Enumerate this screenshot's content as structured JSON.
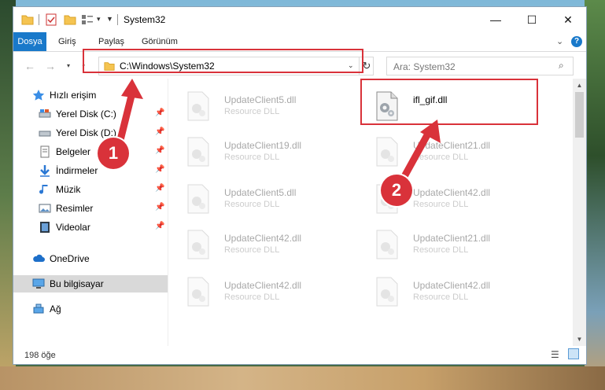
{
  "window": {
    "title": "System32",
    "controls": {
      "minimize": "—",
      "maximize": "☐",
      "close": "✕"
    }
  },
  "ribbon": {
    "tabs": [
      {
        "label": "Dosya"
      },
      {
        "label": "Giriş"
      },
      {
        "label": "Paylaş"
      },
      {
        "label": "Görünüm"
      }
    ],
    "help": "?"
  },
  "address": {
    "path": "C:\\Windows\\System32",
    "search_placeholder": "Ara: System32"
  },
  "nav": {
    "quick_access": "Hızlı erişim",
    "items": [
      {
        "label": "Yerel Disk (C:)"
      },
      {
        "label": "Yerel Disk (D:)"
      },
      {
        "label": "Belgeler"
      },
      {
        "label": "İndirmeler"
      },
      {
        "label": "Müzik"
      },
      {
        "label": "Resimler"
      },
      {
        "label": "Videolar"
      }
    ],
    "onedrive": "OneDrive",
    "this_pc": "Bu bilgisayar",
    "network": "Ağ"
  },
  "files": [
    {
      "name": "UpdateClient5.dll",
      "type": "Resource DLL"
    },
    {
      "name": "ifl_gif.dll",
      "type": ""
    },
    {
      "name": "UpdateClient19.dll",
      "type": "Resource DLL"
    },
    {
      "name": "UpdateClient21.dll",
      "type": "Resource DLL"
    },
    {
      "name": "UpdateClient5.dll",
      "type": "Resource DLL"
    },
    {
      "name": "UpdateClient42.dll",
      "type": "Resource DLL"
    },
    {
      "name": "UpdateClient42.dll",
      "type": "Resource DLL"
    },
    {
      "name": "UpdateClient21.dll",
      "type": "Resource DLL"
    },
    {
      "name": "UpdateClient42.dll",
      "type": "Resource DLL"
    },
    {
      "name": "UpdateClient42.dll",
      "type": "Resource DLL"
    }
  ],
  "callouts": {
    "one": "1",
    "two": "2"
  },
  "status": {
    "count": "198 öğe"
  },
  "colors": {
    "accent": "#1979ca",
    "highlight": "#d9323a",
    "selection": "#d9d9d9"
  }
}
